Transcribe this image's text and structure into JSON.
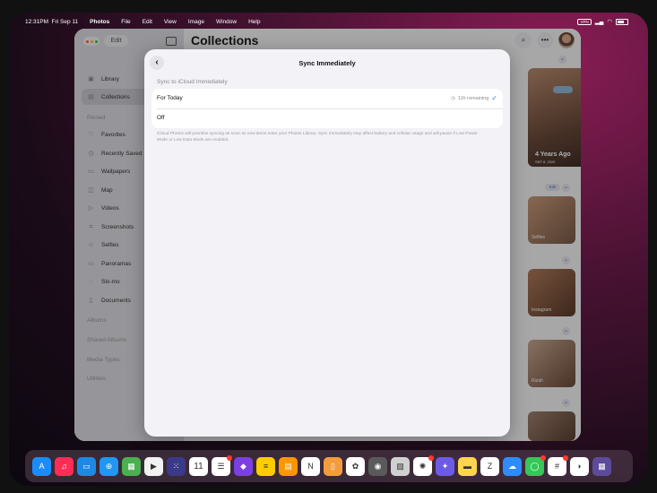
{
  "menubar": {
    "time": "12:31PM",
    "date": "Fri Sep 11",
    "app_name": "Photos",
    "menus": [
      "File",
      "Edit",
      "View",
      "Image",
      "Window",
      "Help"
    ],
    "vpn": "VPN"
  },
  "sidebar": {
    "edit_label": "Edit",
    "top_items": [
      {
        "label": "Library",
        "icon": "library-icon"
      },
      {
        "label": "Collections",
        "icon": "collections-icon",
        "active": true
      }
    ],
    "pinned_header": "Pinned",
    "pinned_items": [
      {
        "label": "Favorites",
        "icon": "heart-icon"
      },
      {
        "label": "Recently Saved",
        "icon": "recently-saved-icon"
      },
      {
        "label": "Wallpapers",
        "icon": "wallpapers-icon"
      },
      {
        "label": "Map",
        "icon": "map-icon"
      },
      {
        "label": "Videos",
        "icon": "video-icon"
      },
      {
        "label": "Screenshots",
        "icon": "screenshot-icon"
      },
      {
        "label": "Selfies",
        "icon": "selfie-icon"
      },
      {
        "label": "Panoramas",
        "icon": "panorama-icon"
      },
      {
        "label": "Slo-mo",
        "icon": "slomo-icon"
      },
      {
        "label": "Documents",
        "icon": "documents-icon"
      }
    ],
    "sections": [
      "Albums",
      "Shared Albums",
      "Media Types",
      "Utilities"
    ]
  },
  "main": {
    "title": "Collections",
    "memory_title": "4 Years Ago",
    "memory_date": "SEP 8, 2020",
    "edit_pill": "Edit",
    "thumb_captions": [
      "Selfies",
      "Instagram",
      "Rizah"
    ]
  },
  "sheet": {
    "title": "Sync Immediately",
    "section_header": "Sync to iCloud Immediately",
    "options": [
      {
        "label": "For Today",
        "detail": "11h remaining",
        "checked": true
      },
      {
        "label": "Off",
        "detail": "",
        "checked": false
      }
    ],
    "footnote": "iCloud Photos will prioritize syncing as soon as new items enter your Photos Library. Sync Immediately may affect battery and cellular usage and will pause if Low Power Mode or Low Data Mode are enabled."
  },
  "dock": {
    "calendar_day": "11",
    "apps": [
      {
        "name": "app-store-icon",
        "color": "#1a8cff",
        "glyph": "A",
        "badge": false
      },
      {
        "name": "music-icon",
        "color": "#ff2d55",
        "glyph": "♫",
        "badge": false
      },
      {
        "name": "files-icon",
        "color": "#1e88e5",
        "glyph": "▭",
        "badge": false
      },
      {
        "name": "safari-icon",
        "color": "#2196f3",
        "glyph": "⊕",
        "badge": false
      },
      {
        "name": "grid-app-icon",
        "color": "#4caf50",
        "glyph": "▦",
        "badge": false
      },
      {
        "name": "youtube-icon",
        "color": "#f2f2f2",
        "glyph": "▶",
        "badge": false
      },
      {
        "name": "launcher-icon",
        "color": "#3a3a8a",
        "glyph": "⁙",
        "badge": false
      },
      {
        "name": "calendar-icon",
        "color": "#ffffff",
        "glyph": "",
        "badge": false
      },
      {
        "name": "reminders-icon",
        "color": "#ffffff",
        "glyph": "☰",
        "badge": true
      },
      {
        "name": "shortcuts-icon",
        "color": "#7b3fe4",
        "glyph": "◆",
        "badge": false
      },
      {
        "name": "notes-icon",
        "color": "#ffcc00",
        "glyph": "≡",
        "badge": false
      },
      {
        "name": "pages-icon",
        "color": "#ff9500",
        "glyph": "▤",
        "badge": false
      },
      {
        "name": "notion-icon",
        "color": "#ffffff",
        "glyph": "N",
        "badge": false
      },
      {
        "name": "iphone-mirroring-icon",
        "color": "#f39c3d",
        "glyph": "▯",
        "badge": false
      },
      {
        "name": "photos-icon",
        "color": "#ffffff",
        "glyph": "✿",
        "badge": false
      },
      {
        "name": "camera-icon",
        "color": "#5a5a5a",
        "glyph": "◉",
        "badge": false
      },
      {
        "name": "preview-icon",
        "color": "#d0d0d0",
        "glyph": "▨",
        "badge": false
      },
      {
        "name": "chatgpt-icon",
        "color": "#ffffff",
        "glyph": "✺",
        "badge": true
      },
      {
        "name": "messenger-icon",
        "color": "#6d5be6",
        "glyph": "✦",
        "badge": false
      },
      {
        "name": "stickies-icon",
        "color": "#ffd54f",
        "glyph": "▬",
        "badge": false
      },
      {
        "name": "zoom-text-icon",
        "color": "#ffffff",
        "glyph": "Z",
        "badge": false
      },
      {
        "name": "weather-icon",
        "color": "#2f8cff",
        "glyph": "☁",
        "badge": false
      },
      {
        "name": "messages-icon",
        "color": "#34c759",
        "glyph": "◯",
        "badge": true
      },
      {
        "name": "slack-icon",
        "color": "#ffffff",
        "glyph": "#",
        "badge": true
      },
      {
        "name": "rss-icon",
        "color": "#ffffff",
        "glyph": "◗",
        "badge": false
      },
      {
        "name": "app-library-icon",
        "color": "#5c4b9a",
        "glyph": "▦",
        "badge": false
      }
    ]
  },
  "colors": {
    "accent": "#2f7cf6",
    "sheet_bg": "#f2f2f7"
  }
}
